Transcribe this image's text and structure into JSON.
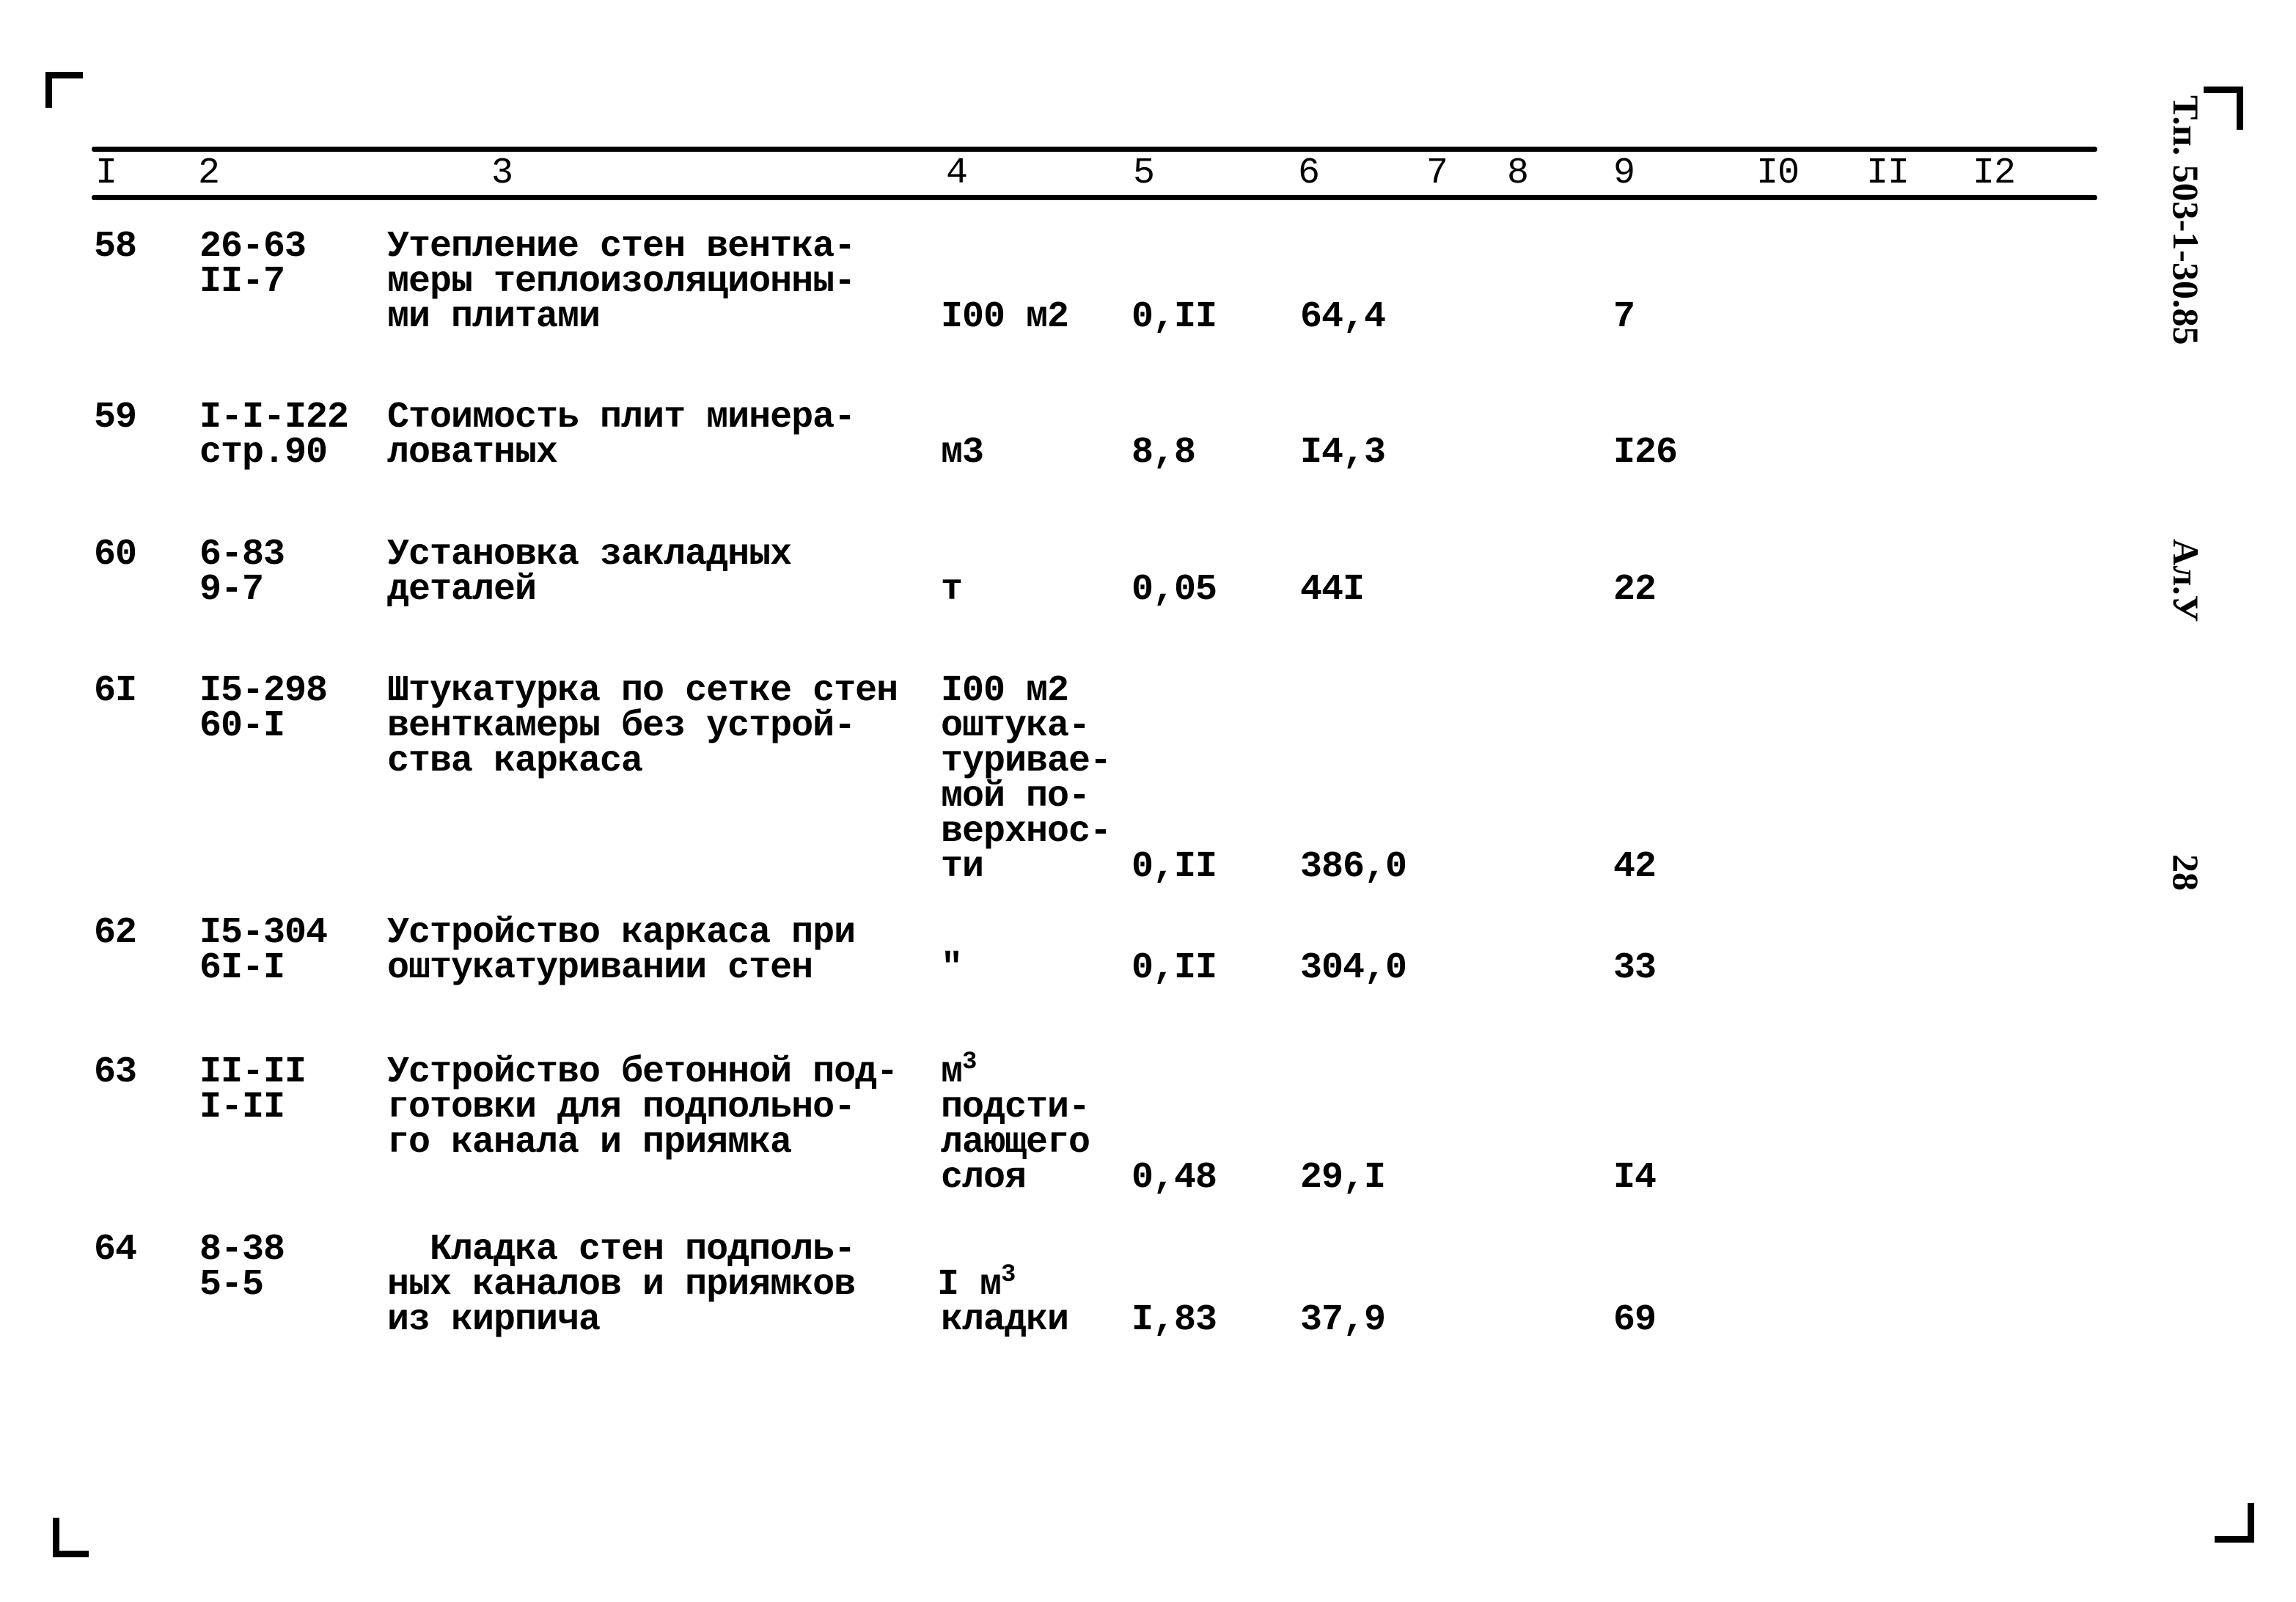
{
  "margin": {
    "doc_code": "Т.п. 503-1-30.85",
    "album": "Ал.У",
    "page_number": "28"
  },
  "header": {
    "columns": [
      "I",
      "2",
      "3",
      "4",
      "5",
      "6",
      "7",
      "8",
      "9",
      "I0",
      "II",
      "I2"
    ]
  },
  "rows": [
    {
      "num": "58",
      "code": [
        "26-63",
        "II-7"
      ],
      "name": [
        "Утепление стен вентка-",
        "меры теплоизоляционны-",
        "ми плитами"
      ],
      "unit": [
        "I00 м2"
      ],
      "qty": "0,II",
      "price": "64,4",
      "total": "7"
    },
    {
      "num": "59",
      "code": [
        "I-I-I22",
        "стр.90"
      ],
      "name": [
        "Стоимость плит минера-",
        "ловатных"
      ],
      "unit": [
        "м3"
      ],
      "qty": "8,8",
      "price": "I4,3",
      "total": "I26"
    },
    {
      "num": "60",
      "code": [
        "6-83",
        "9-7"
      ],
      "name": [
        "Установка закладных",
        "деталей"
      ],
      "unit": [
        "т"
      ],
      "qty": "0,05",
      "price": "44I",
      "total": "22"
    },
    {
      "num": "6I",
      "code": [
        "I5-298",
        "60-I"
      ],
      "name": [
        "Штукатурка по сетке стен",
        "венткамеры без устрой-",
        "ства каркаса"
      ],
      "unit": [
        "I00 м2",
        "оштука-",
        "туривае-",
        "мой по-",
        "верхнос-",
        "ти"
      ],
      "qty": "0,II",
      "price": "386,0",
      "total": "42"
    },
    {
      "num": "62",
      "code": [
        "I5-304",
        "6I-I"
      ],
      "name": [
        "Устройство каркаса при",
        "оштукатуривании стен"
      ],
      "unit": [
        "\""
      ],
      "qty": "0,II",
      "price": "304,0",
      "total": "33"
    },
    {
      "num": "63",
      "code": [
        "II-II",
        "I-II"
      ],
      "name": [
        "Устройство бетонной под-",
        "готовки для подпольно-",
        "го канала и приямка"
      ],
      "unit": [
        "м",
        "подсти-",
        "лающего",
        "слоя"
      ],
      "unit_sup": "3",
      "qty": "0,48",
      "price": "29,I",
      "total": "I4"
    },
    {
      "num": "64",
      "code": [
        "8-38",
        "5-5"
      ],
      "name": [
        "  Кладка стен подполь-",
        "ных каналов и приямков",
        "из кирпича"
      ],
      "unit": [
        "I м",
        "кладки"
      ],
      "unit_sup": "3",
      "qty": "I,83",
      "price": "37,9",
      "total": "69"
    }
  ]
}
